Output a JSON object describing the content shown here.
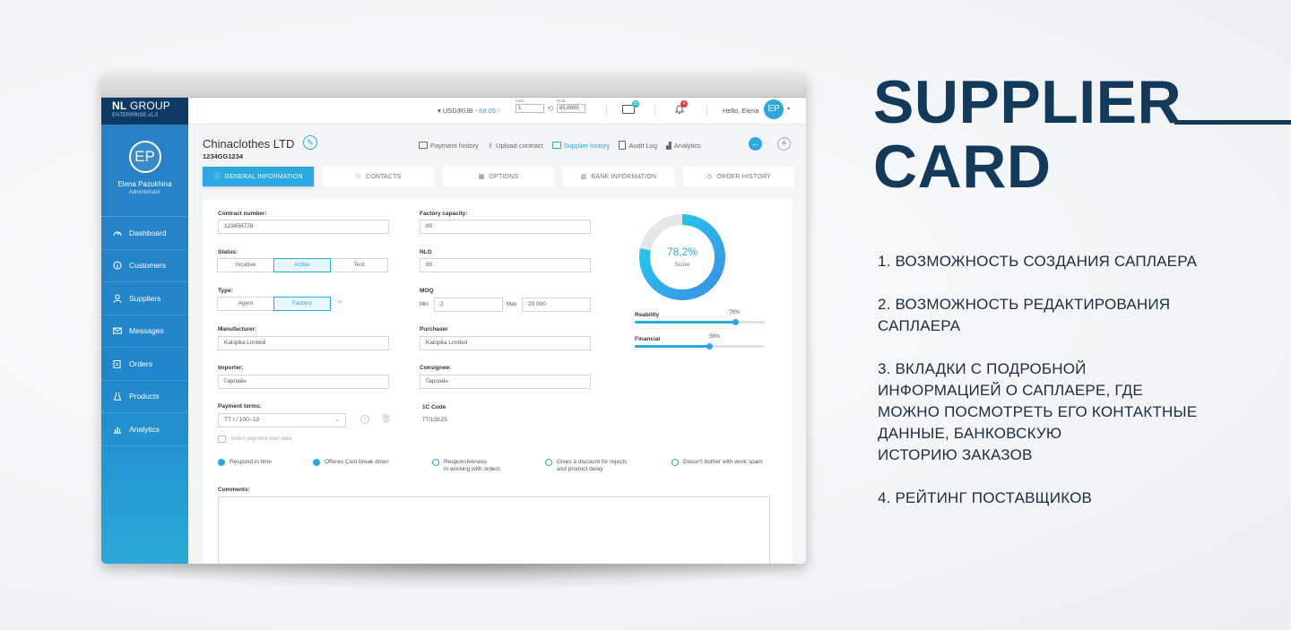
{
  "app": {
    "brand": {
      "name_bold": "NL",
      "name_rest": " GROUP",
      "edition": "ENTERPRISE v1.0"
    },
    "user": {
      "initials": "EP",
      "name": "Elena Pazukhina",
      "role": "Administrator",
      "greeting": "Hello, Elena"
    },
    "nav": [
      {
        "label": "Dashboard",
        "icon": "speedometer-icon"
      },
      {
        "label": "Customers",
        "icon": "info-circle-icon"
      },
      {
        "label": "Suppliers",
        "icon": "person-icon"
      },
      {
        "label": "Messages",
        "icon": "envelope-icon"
      },
      {
        "label": "Orders",
        "icon": "clipboard-icon"
      },
      {
        "label": "Products",
        "icon": "dress-icon"
      },
      {
        "label": "Analytics",
        "icon": "bar-chart-icon"
      }
    ],
    "topbar": {
      "currency_pair": "USD/RUB",
      "rate": "68.05",
      "usd_label": "USD",
      "usd_value": "1",
      "rub_label": "RUB",
      "rub_value": "65,6899",
      "messages_count": "20",
      "notifications_count": "4"
    },
    "supplier": {
      "name": "Chinaclothes LTD",
      "code": "1234GG1234"
    },
    "actions": [
      {
        "label": "Payment history",
        "active": false
      },
      {
        "label": "Upload contract",
        "active": false
      },
      {
        "label": "Supplier history",
        "active": true
      },
      {
        "label": "Audit Log",
        "active": false
      },
      {
        "label": "Analytics",
        "active": false
      }
    ],
    "tabs": [
      "GENERAL INFORMATION",
      "CONTACTS",
      "OPTIONS",
      "BANK INFORMATION",
      "ORDER HISTORY"
    ],
    "form": {
      "contract_number_label": "Contract number:",
      "contract_number": "123456778",
      "factory_capacity_label": "Factory capacity:",
      "factory_capacity": "80",
      "status_label": "Status:",
      "status_options": [
        "Incative",
        "Active",
        "Test"
      ],
      "nlg_label": "NLG",
      "nlg": "80",
      "type_label": "Type:",
      "type_options": [
        "Agent",
        "Factory"
      ],
      "moq_label": "MOQ",
      "moq_min_label": "Min",
      "moq_min": "2",
      "moq_max_label": "Max",
      "moq_max": "20 000",
      "manufacturer_label": "Manufacturer:",
      "manufacturer": "Kalopka Limited",
      "purchaser_label": "Purchaser",
      "purchaser": "Kalopka Limited",
      "importer_label": "Importer:",
      "importer": "Гарлайн",
      "consignee_label": "Consignee:",
      "consignee": "Гарлайн",
      "payment_terms_label": "Payment terms:",
      "payment_terms": "TT / / 100--10",
      "onec_label": "1C Code",
      "onec": "TT/100-25",
      "payment_date_placeholder": "Select payment start date",
      "comments_label": "Comments:"
    },
    "checks": [
      {
        "line1": "Respond in time",
        "line2": "",
        "checked": true
      },
      {
        "line1": "Offeres Cost break down",
        "line2": "",
        "checked": true
      },
      {
        "line1": "Responsiveness",
        "line2": "in working with orders",
        "checked": false
      },
      {
        "line1": "Gives a discount for rejects",
        "line2": "and product delay",
        "checked": false
      },
      {
        "line1": "Doesn't bother with work spam",
        "line2": "",
        "checked": false
      }
    ],
    "score": {
      "value_text": "78,2%",
      "label": "Score",
      "value": 78.2
    },
    "ratings": [
      {
        "label": "Reability",
        "value_text": "78%",
        "value": 78
      },
      {
        "label": "Financial",
        "value_text": "58%",
        "value": 58
      }
    ]
  },
  "promo": {
    "title_line1": "SUPPLIER",
    "title_line2": "CARD",
    "points": [
      [
        "1. ВОЗМОЖНОСТЬ СОЗДАНИЯ САПЛАЕРА"
      ],
      [
        "2. ВОЗМОЖНОСТЬ РЕДАКТИРОВАНИЯ",
        "САПЛАЕРА"
      ],
      [
        "3. ВКЛАДКИ С ПОДРОБНОЙ",
        "ИНФОРМАЦИЕЙ О САПЛАЕРЕ, ГДЕ",
        "МОЖНО ПОСМОТРЕТЬ ЕГО КОНТАКТНЫЕ",
        "ДАННЫЕ, БАНКОВСКУЮ",
        "ИСТОРИЮ ЗАКАЗОВ"
      ],
      [
        "4. РЕЙТИНГ ПОСТАВЩИКОВ"
      ]
    ],
    "colors": {
      "title": "#133a5a",
      "accent": "#2aa8e0"
    }
  }
}
